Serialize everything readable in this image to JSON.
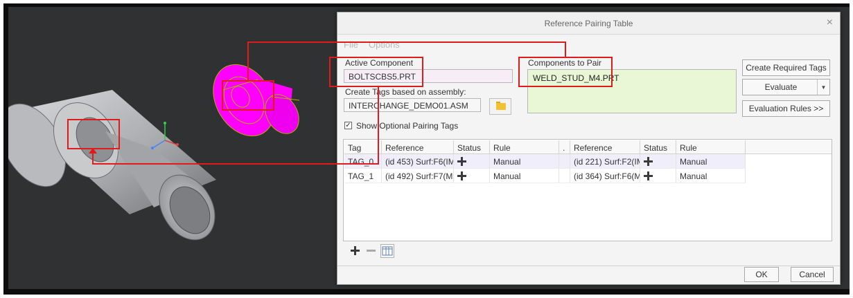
{
  "dialog": {
    "title": "Reference Pairing Table",
    "close_glyph": "×",
    "menu": {
      "file": "File",
      "options": "Options"
    },
    "active_component": {
      "label": "Active Component",
      "value": "BOLTSCBS5.PRT"
    },
    "create_tags": {
      "label": "Create Tags based on assembly:",
      "value": "INTERCHANGE_DEMO01.ASM"
    },
    "components_to_pair": {
      "label": "Components to Pair",
      "items": [
        "WELD_STUD_M4.PRT"
      ]
    },
    "show_optional": {
      "label": "Show Optional Pairing Tags",
      "checked": true
    },
    "buttons": {
      "create_required_tags": "Create Required Tags",
      "evaluate": "Evaluate",
      "evaluation_rules": "Evaluation Rules >>",
      "ok": "OK",
      "cancel": "Cancel"
    },
    "table": {
      "headers": [
        "Tag",
        "Reference",
        "Status",
        "Rule",
        ".",
        "Reference",
        "Status",
        "Rule"
      ],
      "rows": [
        {
          "tag": "TAG_0",
          "ref1": "(id 453) Surf:F6(IM",
          "status1": "plus-icon",
          "rule1": "Manual",
          "ref2": "(id 221) Surf:F2(IM",
          "status2": "plus-icon",
          "rule2": "Manual"
        },
        {
          "tag": "TAG_1",
          "ref1": "(id 492) Surf:F7(M",
          "status1": "plus-icon",
          "rule1": "Manual",
          "ref2": "(id 364) Surf:F6(M",
          "status2": "plus-icon",
          "rule2": "Manual"
        }
      ]
    },
    "toolbar_icons": [
      "add-icon",
      "remove-icon",
      "table-columns-icon"
    ]
  },
  "colors": {
    "viewport_bg": "#2f3132",
    "highlight_part": "#ff00ff",
    "annotation": "#e11a1a",
    "pair_list_bg": "#eaf7d7",
    "active_field_bg": "#f6edf6"
  }
}
